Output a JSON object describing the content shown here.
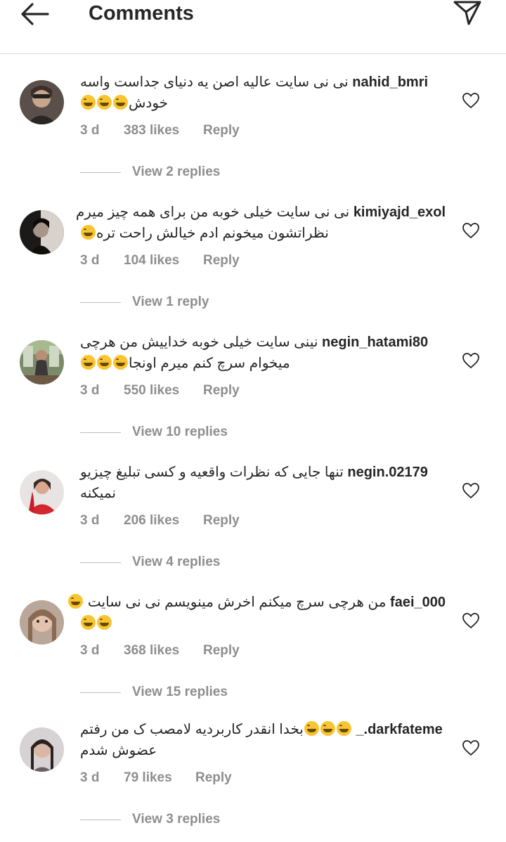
{
  "header": {
    "title": "Comments"
  },
  "comments": [
    {
      "username": "nahid_bmri",
      "line1": "نی نی سایت عالیه اصن یه دنیای جداست واسه",
      "line2": "خودش",
      "emoji_count_line2": 3,
      "time": "3 d",
      "likes": "383 likes",
      "reply": "Reply",
      "view_replies": "View 2 replies"
    },
    {
      "username": "kimiyajd_exol",
      "line1": "نی نی سایت خیلی خوبه من برای همه چیز میرم",
      "line2": "نظراتشون میخونم ادم خیالش راحت تره",
      "emoji_count_line2": 1,
      "time": "3 d",
      "likes": "104 likes",
      "reply": "Reply",
      "view_replies": "View 1 reply"
    },
    {
      "username": "negin_hatami80",
      "line1": "نینی سایت خیلی خوبه خداییش من هرچی",
      "line2": "میخوام سرچ کنم میرم اونجا",
      "emoji_count_line2": 3,
      "time": "3 d",
      "likes": "550 likes",
      "reply": "Reply",
      "view_replies": "View 10 replies"
    },
    {
      "username": "negin.02179",
      "line1": "تنها جایی که نظرات واقعیه و کسی تبلیغ چیزیو",
      "line2": "نمیکنه",
      "emoji_count_line2": 0,
      "time": "3 d",
      "likes": "206 likes",
      "reply": "Reply",
      "view_replies": "View 4 replies"
    },
    {
      "username": "faei_000",
      "line1": "من هرچی سرچ میکنم اخرش مینویسم نی نی سایت",
      "line2": "",
      "emoji_count_line2": 2,
      "time": "3 d",
      "likes": "368 likes",
      "reply": "Reply",
      "view_replies": "View 15 replies"
    },
    {
      "username": "_.darkfateme",
      "line1": "بخدا انقدر کاربردیه لامصب ک من رفتم",
      "line2": "عضوش شدم",
      "emoji_count_line2": 0,
      "time": "3 d",
      "likes": "79 likes",
      "reply": "Reply",
      "view_replies": "View 3 replies"
    }
  ],
  "icons": {
    "back": "arrow-left-icon",
    "send": "paper-plane-icon",
    "like": "heart-outline-icon",
    "emoji": "face-with-tears-of-joy-emoji"
  },
  "colors": {
    "text": "#262626",
    "secondary": "#8e8e8e",
    "divider": "#dbdbdb",
    "emoji": "#f7c531"
  }
}
